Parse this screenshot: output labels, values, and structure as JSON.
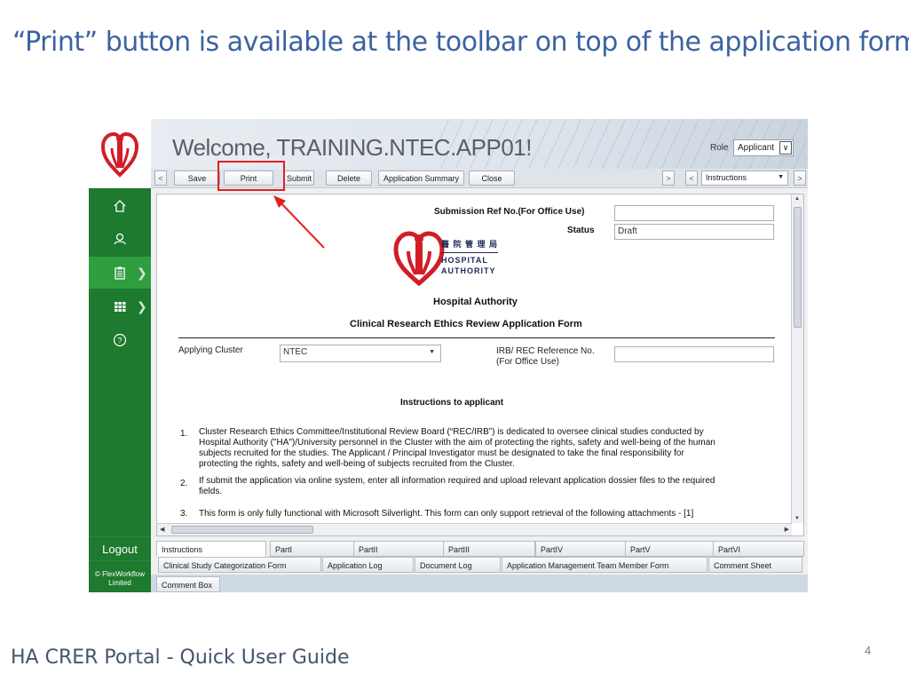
{
  "slide": {
    "title": "“Print” button is available at the toolbar on top of the application form",
    "footer": "HA CRER Portal - Quick User Guide",
    "page_number": "4"
  },
  "header": {
    "welcome": "Welcome, TRAINING.NTEC.APP01!",
    "role_label": "Role",
    "role_value": "Applicant"
  },
  "sidebar": {
    "items": [
      {
        "icon": "home-icon"
      },
      {
        "icon": "user-icon"
      },
      {
        "icon": "clipboard-icon"
      },
      {
        "icon": "grid-icon"
      },
      {
        "icon": "help-icon"
      }
    ],
    "logout": "Logout",
    "copyright": "© FlexWorkflow Limited"
  },
  "toolbar": {
    "nav_prev": "<",
    "buttons": [
      "Save",
      "Print",
      "Submit",
      "Delete",
      "Application Summary",
      "Close"
    ],
    "nav_next": ">",
    "nav_prev2": "<",
    "section_select": "Instructions",
    "nav_next2": ">"
  },
  "form": {
    "submission_ref_label": "Submission Ref No.(For Office Use)",
    "submission_ref_value": "",
    "status_label": "Status",
    "status_value": "Draft",
    "ha_chinese": "醫 院 管 理 局",
    "ha_english_1": "HOSPITAL",
    "ha_english_2": "AUTHORITY",
    "org_title": "Hospital Authority",
    "form_title": "Clinical Research Ethics Review Application Form",
    "applying_cluster_label": "Applying Cluster",
    "applying_cluster_value": "NTEC",
    "irb_label_1": "IRB/ REC Reference No.",
    "irb_label_2": "(For Office Use)",
    "irb_value": "",
    "instructions_heading": "Instructions to applicant",
    "instructions": [
      {
        "num": "1.",
        "lines": [
          "Cluster Research Ethics Committee/Institutional Review Board (“REC/IRB”) is dedicated to oversee clinical studies conducted by",
          "Hospital Authority (\"HA\")/University personnel in the Cluster with the aim of protecting the rights, safety and well-being of the human",
          "subjects recruited for the studies. The Applicant / Principal Investigator must be designated to take the final responsibility for",
          "protecting the rights, safety and well-being of subjects recruited from the Cluster."
        ]
      },
      {
        "num": "2.",
        "lines": [
          "If submit the application via online system, enter all information required and upload relevant application dossier files to the required",
          "fields."
        ]
      },
      {
        "num": "3.",
        "lines": [
          "This form is only fully functional with Microsoft Silverlight. This form can only support retrieval of the following attachments - [1]"
        ]
      }
    ]
  },
  "tabs": {
    "row1": [
      "Instructions",
      "PartI",
      "PartII",
      "PartIII",
      "PartIV",
      "PartV",
      "PartVI"
    ],
    "row2": [
      "Clinical Study Categorization Form",
      "Application Log",
      "Document Log",
      "Application Management Team Member Form",
      "Comment Sheet"
    ],
    "row3": [
      "Comment Box"
    ]
  },
  "colors": {
    "sidebar_green": "#1d7a2e",
    "active_green": "#2f9e3f",
    "highlight_red": "#e02020",
    "title_blue": "#3a63a0"
  }
}
